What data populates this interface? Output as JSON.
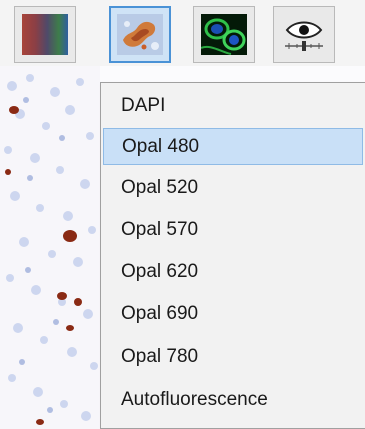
{
  "toolbar": {
    "buttons": [
      {
        "icon": "spectrum-icon",
        "active": false
      },
      {
        "icon": "brightfield-tissue-icon",
        "active": true
      },
      {
        "icon": "fluorescence-icon",
        "active": false
      },
      {
        "icon": "eye-slider-icon",
        "active": false
      }
    ]
  },
  "dropdown": {
    "selected": "Opal 480",
    "items": [
      {
        "label": "DAPI"
      },
      {
        "label": "Opal 480"
      },
      {
        "label": "Opal 520"
      },
      {
        "label": "Opal 570"
      },
      {
        "label": "Opal 620"
      },
      {
        "label": "Opal 690"
      },
      {
        "label": "Opal 780"
      },
      {
        "label": "Autofluorescence"
      }
    ]
  },
  "colors": {
    "selection_bg": "#c9e0f7",
    "active_button_border": "#4a92d6",
    "menu_bg": "#f2f2f2"
  }
}
